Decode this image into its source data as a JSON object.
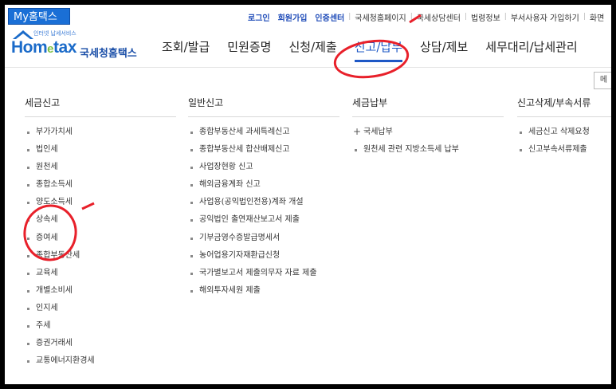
{
  "header": {
    "my_badge": "My홈택스",
    "util_bold": [
      "로그인",
      "회원가입",
      "인증센터"
    ],
    "util_plain": [
      "국세청홈페이지",
      "국세상담센터",
      "법령정보",
      "부서사용자 가입하기",
      "화면"
    ]
  },
  "logo": {
    "small_text": "인터넷 납세서비스",
    "word_a": "Hom",
    "word_e": "e",
    "word_b": "tax",
    "korean": "국세청홈택스"
  },
  "nav": {
    "items": [
      "조회/발급",
      "민원증명",
      "신청/제출",
      "신고/납부",
      "상담/제보",
      "세무대리/납세관리"
    ],
    "active_index": 3
  },
  "side_button": "메",
  "columns": [
    {
      "title": "세금신고",
      "items": [
        "부가가치세",
        "법인세",
        "원천세",
        "종합소득세",
        "양도소득세",
        "상속세",
        "증여세",
        "종합부동산세",
        "교육세",
        "개별소비세",
        "인지세",
        "주세",
        "증권거래세",
        "교통에너지환경세"
      ]
    },
    {
      "title": "일반신고",
      "items": [
        "종합부동산세 과세특례신고",
        "종합부동산세 합산배제신고",
        "사업장현황 신고",
        "해외금융계좌 신고",
        "사업용(공익법인전용)계좌 개설",
        "공익법인 출연재산보고서 제출",
        "기부금영수증발급명세서",
        "농어업용기자재환급신청",
        "국가별보고서 제출의무자 자료 제출",
        "해외투자세원 제출"
      ]
    },
    {
      "title": "세금납부",
      "items": [
        "국세납부",
        "원천세 관련 지방소득세 납부"
      ]
    },
    {
      "title": "신고삭제/부속서류",
      "items": [
        "세금신고 삭제요청",
        "신고부속서류제출"
      ]
    }
  ],
  "colors": {
    "accent": "#1e58c6",
    "annotation": "#e8202a"
  }
}
